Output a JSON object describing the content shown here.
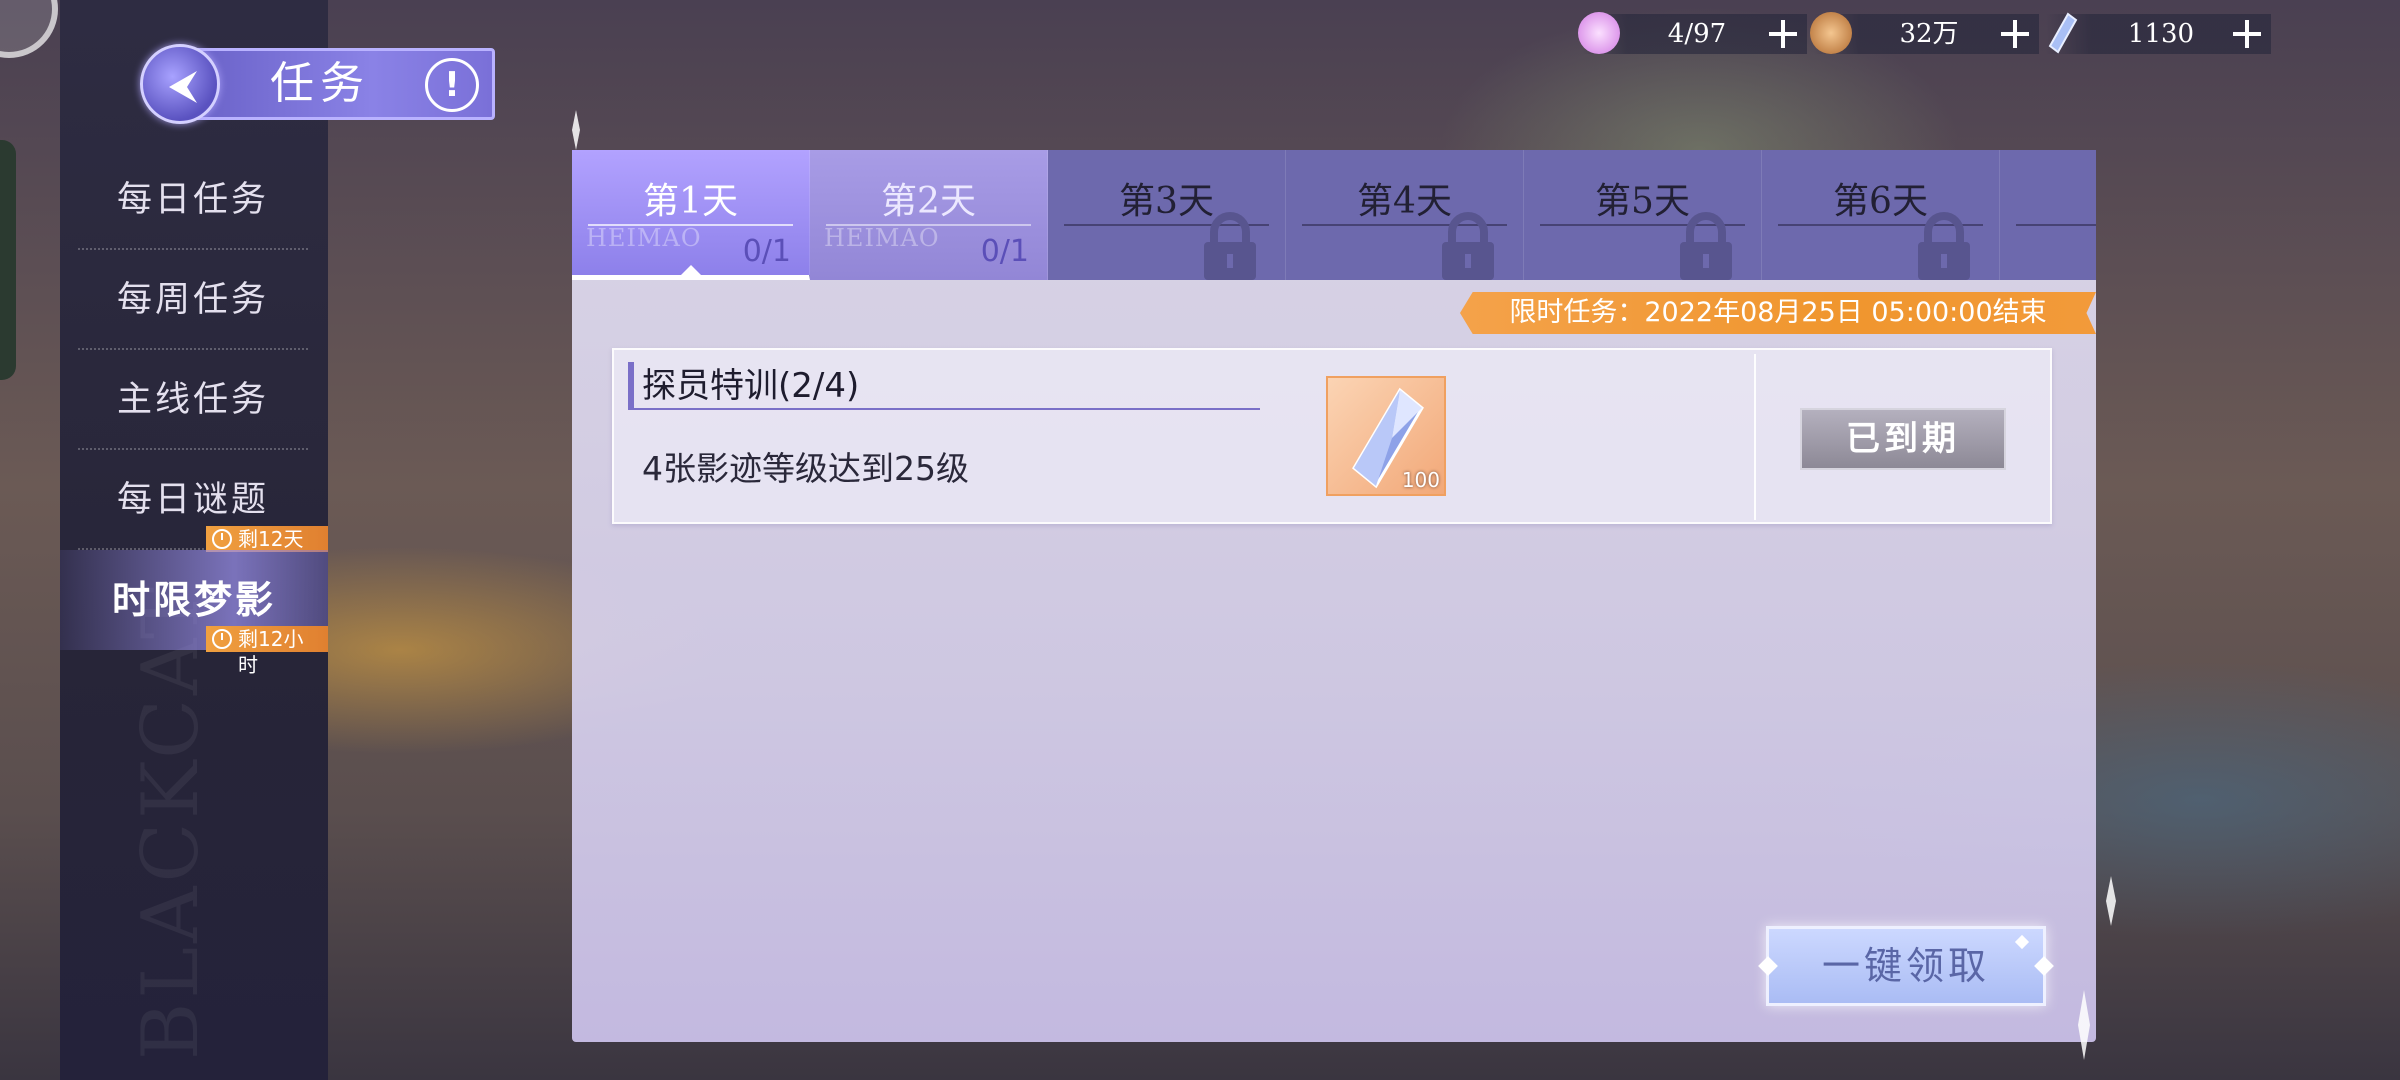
{
  "header": {
    "title": "任务",
    "info_symbol": "!"
  },
  "sidebar": {
    "watermark": "BLACKCAT",
    "items": [
      {
        "label": "每日任务"
      },
      {
        "label": "每周任务"
      },
      {
        "label": "主线任务"
      },
      {
        "label": "每日谜题",
        "timer": "剩12天"
      },
      {
        "label": "时限梦影",
        "timer": "剩12小时",
        "active": true
      }
    ]
  },
  "currencies": [
    {
      "icon": "stamina-icon",
      "value": "4/97",
      "color": "#e9b6f2"
    },
    {
      "icon": "coin-icon",
      "value": "32万",
      "color": "#d89a5c"
    },
    {
      "icon": "crystal-icon",
      "value": "1130",
      "color": "#9fb4f0"
    }
  ],
  "tabs": [
    {
      "label": "第1天",
      "progress": "0/1",
      "watermark": "HEIMAO",
      "state": "active"
    },
    {
      "label": "第2天",
      "progress": "0/1",
      "watermark": "HEIMAO",
      "state": "unlocked"
    },
    {
      "label": "第3天",
      "state": "locked"
    },
    {
      "label": "第4天",
      "state": "locked"
    },
    {
      "label": "第5天",
      "state": "locked"
    },
    {
      "label": "第6天",
      "state": "locked"
    },
    {
      "label": "第",
      "state": "locked"
    }
  ],
  "limited_banner": "限时任务：2022年08月25日  05:00:00结束",
  "tasks": [
    {
      "title": "探员特训(2/4)",
      "description": "4张影迹等级达到25级",
      "reward": {
        "icon": "crystal-icon",
        "count": "100"
      },
      "button": "已到期"
    }
  ],
  "claim_all_label": "一键领取",
  "colors": {
    "accent": "#8d80ea",
    "banner": "#f0962e",
    "timer_badge": "#e08030"
  }
}
